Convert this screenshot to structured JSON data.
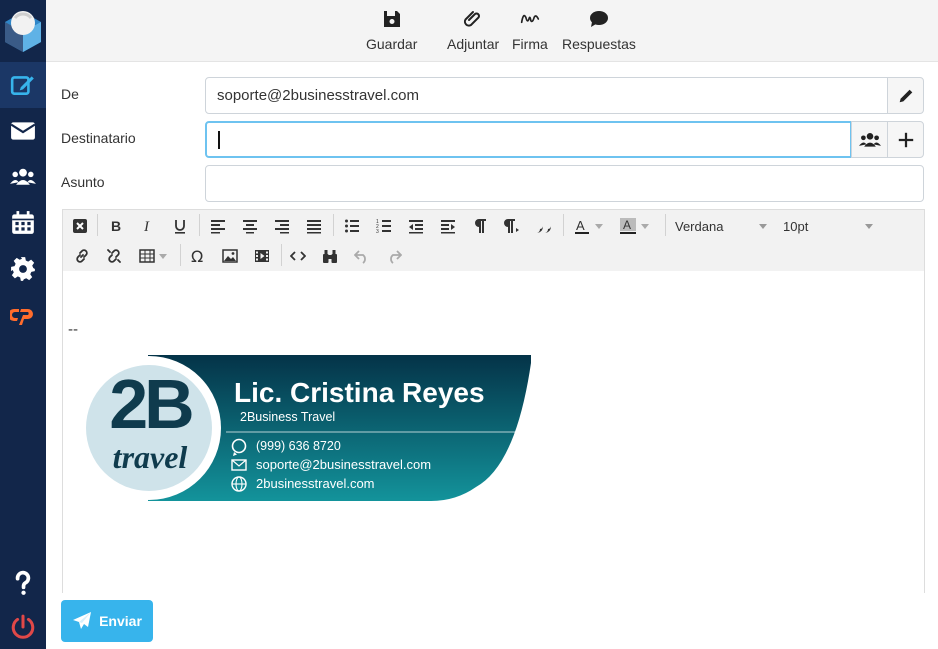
{
  "colors": {
    "sidebar": "#12264a",
    "sidebar_active": "#1b3766",
    "accent": "#37b4ec",
    "focus_border": "#6ec3f0",
    "logout": "#e04848",
    "cpanel": "#ff6c2c"
  },
  "sidebar": {
    "items": [
      {
        "icon": "compose-icon",
        "active": true
      },
      {
        "icon": "mail-icon"
      },
      {
        "icon": "contacts-icon"
      },
      {
        "icon": "calendar-icon"
      },
      {
        "icon": "gear-icon"
      },
      {
        "icon": "cpanel-icon"
      }
    ],
    "bottom": [
      {
        "icon": "help-icon"
      },
      {
        "icon": "logout-icon"
      }
    ]
  },
  "toolbar": {
    "save_label": "Guardar",
    "attach_label": "Adjuntar",
    "signature_label": "Firma",
    "responses_label": "Respuestas"
  },
  "form": {
    "from_label": "De",
    "from_value": "soporte@2businesstravel.com",
    "to_label": "Destinatario",
    "to_value": "",
    "subject_label": "Asunto",
    "subject_value": ""
  },
  "editor": {
    "font_family": "Verdana",
    "font_size": "10pt",
    "signature_separator": "--"
  },
  "signature": {
    "logo_main": "2B",
    "logo_sub": "travel",
    "name": "Lic. Cristina Reyes",
    "company": "2Business Travel",
    "phone": "(999) 636 8720",
    "email": "soporte@2businesstravel.com",
    "website": "2businesstravel.com"
  },
  "send_label": "Enviar"
}
